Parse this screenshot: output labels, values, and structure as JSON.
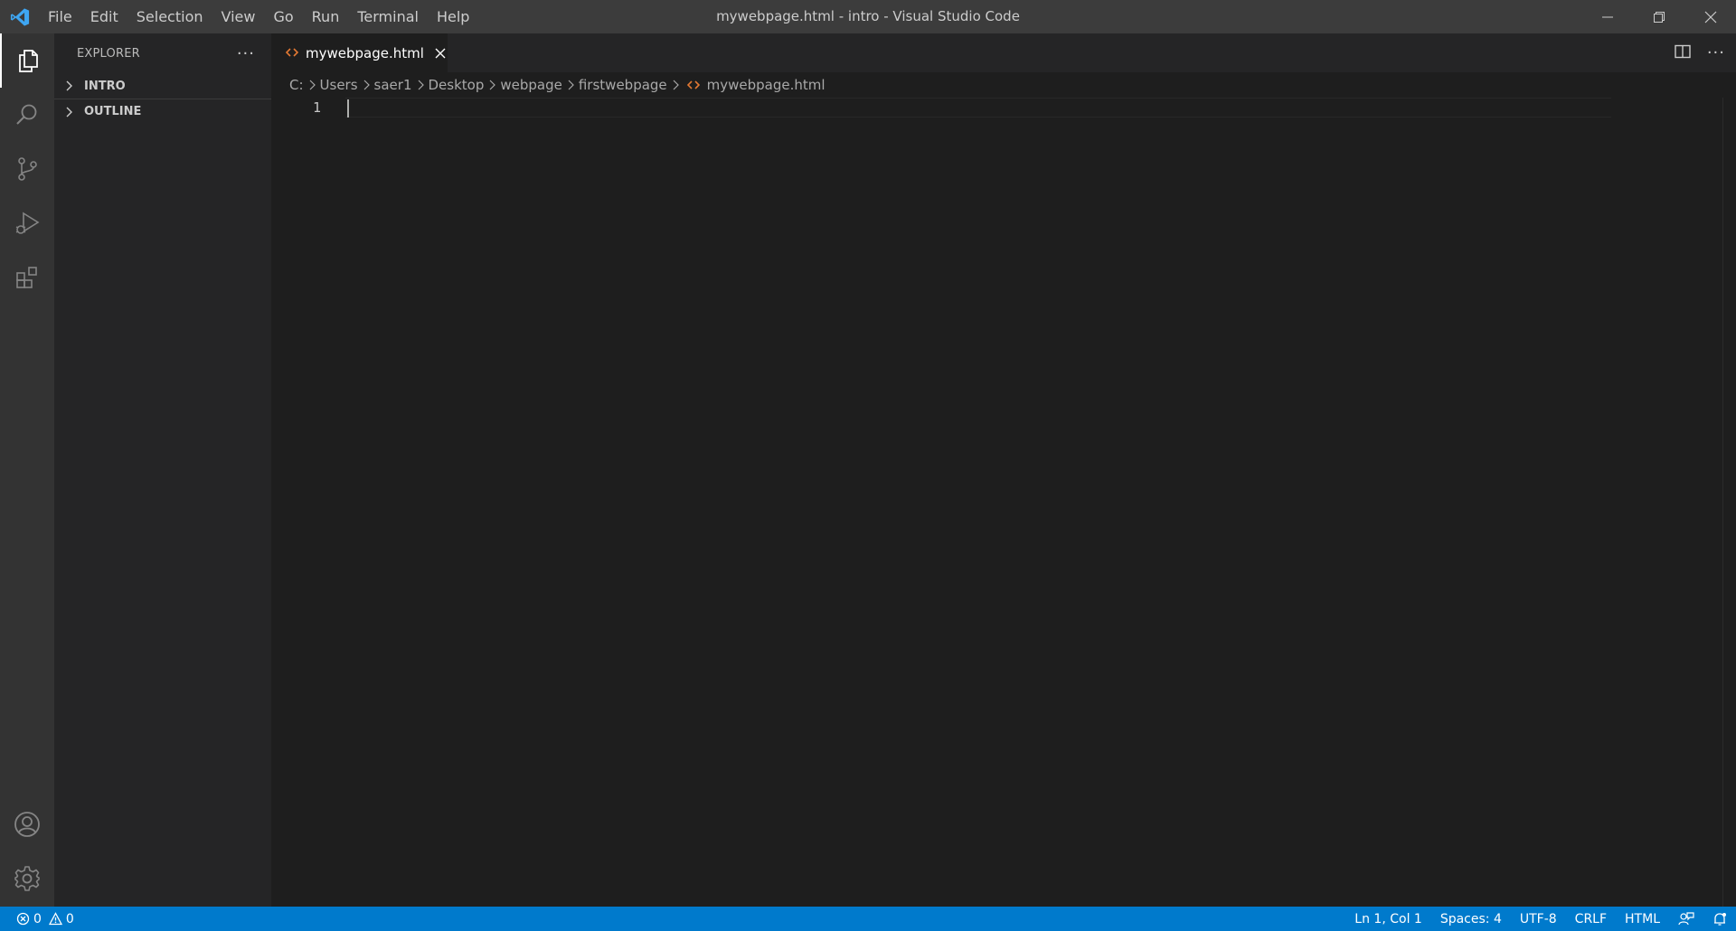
{
  "window": {
    "title": "mywebpage.html - intro - Visual Studio Code"
  },
  "menu": {
    "items": [
      "File",
      "Edit",
      "Selection",
      "View",
      "Go",
      "Run",
      "Terminal",
      "Help"
    ]
  },
  "activity_bar": {
    "top_icons": [
      "files-icon",
      "search-icon",
      "source-control-icon",
      "run-debug-icon",
      "extensions-icon"
    ],
    "bottom_icons": [
      "account-icon",
      "settings-gear-icon"
    ]
  },
  "sidebar": {
    "title": "EXPLORER",
    "sections": [
      {
        "label": "INTRO"
      },
      {
        "label": "OUTLINE"
      }
    ]
  },
  "editor": {
    "tab": {
      "label": "mywebpage.html",
      "icon": "html-file-icon"
    },
    "breadcrumb": [
      "C:",
      "Users",
      "saer1",
      "Desktop",
      "webpage",
      "firstwebpage",
      "mywebpage.html"
    ],
    "line_numbers": [
      "1"
    ]
  },
  "status_bar": {
    "errors": "0",
    "warnings": "0",
    "position": "Ln 1, Col 1",
    "indent": "Spaces: 4",
    "encoding": "UTF-8",
    "eol": "CRLF",
    "language": "HTML"
  },
  "colors": {
    "accent": "#007acc",
    "title_bar": "#3c3c3c",
    "activity_bar": "#333333",
    "sidebar": "#252526",
    "editor": "#1e1e1e",
    "html_icon": "#e37933"
  }
}
